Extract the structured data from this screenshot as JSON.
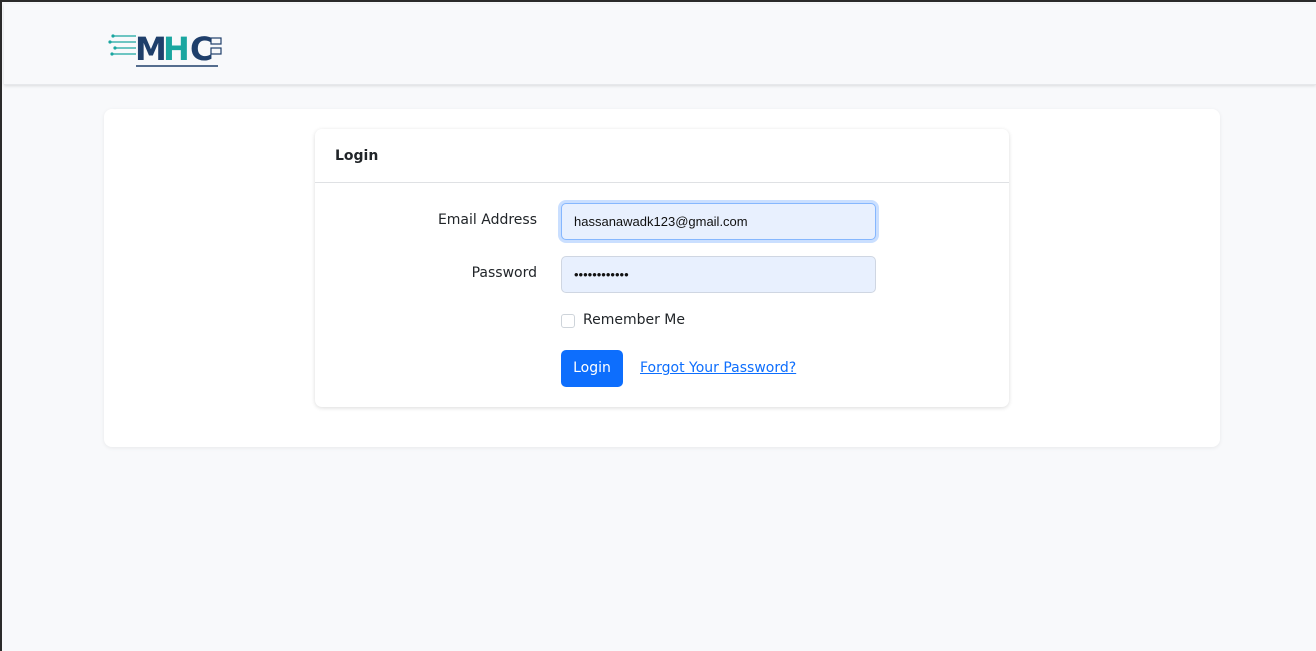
{
  "brand": {
    "logo_text": "MHC",
    "colors": {
      "primary": "#0d6efd",
      "logo_dark": "#1f3f6b",
      "logo_teal": "#1aa6a0"
    }
  },
  "card": {
    "title": "Login"
  },
  "form": {
    "email_label": "Email Address",
    "email_value": "hassanawadk123@gmail.com",
    "password_label": "Password",
    "password_value": "••••••••••••",
    "remember_label": "Remember Me",
    "remember_checked": false,
    "submit_label": "Login",
    "forgot_label": "Forgot Your Password?"
  }
}
